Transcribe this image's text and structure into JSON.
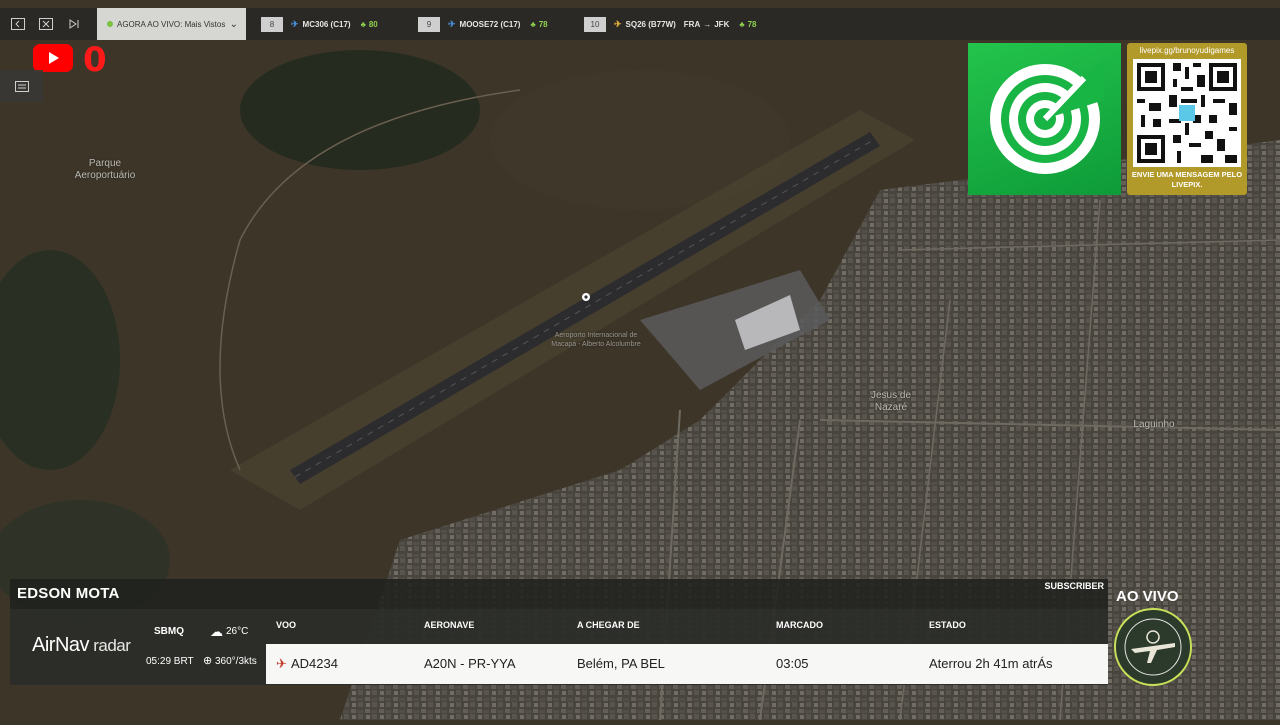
{
  "topbar": {
    "live_label": "AGORA AO VIVO: Mais Vistos",
    "flights": [
      {
        "rank": "8",
        "callsign": "MC306 (C17)",
        "route_from": "",
        "route_to": "",
        "fuel": "80"
      },
      {
        "rank": "9",
        "callsign": "MOOSE72 (C17)",
        "route_from": "",
        "route_to": "",
        "fuel": "78"
      },
      {
        "rank": "10",
        "callsign": "SQ26 (B77W)",
        "route_from": "FRA",
        "route_to": "JFK",
        "fuel": "78"
      }
    ]
  },
  "youtube": {
    "count": "0"
  },
  "map": {
    "labels": {
      "park": "Parque Aeroportuário",
      "airport": "Aeroporto Internacional de Macapá - Alberto Alcolumbre",
      "district": "Jesus de Nazaré",
      "laguinho": "Laguinho"
    }
  },
  "livepix": {
    "url": "livepix.gg/brunoyudigames",
    "message": "ENVIE UMA MENSAGEM PELO LIVEPIX."
  },
  "panel": {
    "streamer": "EDSON MOTA",
    "subscriber": "SUBSCRIBER",
    "logo_main": "AirNav",
    "logo_sub": " radar",
    "airport_code": "SBMQ",
    "local_time": "05:29 BRT",
    "temperature": "26°C",
    "wind": "360°/3kts",
    "headers": {
      "flight": "VOO",
      "aircraft": "AERONAVE",
      "from": "A CHEGAR DE",
      "scheduled": "MARCADO",
      "status": "ESTADO"
    },
    "row": {
      "flight": "AD4234",
      "aircraft": "A20N - PR-YYA",
      "from": "Belém, PA BEL",
      "scheduled": "03:05",
      "status": "Aterrou 2h 41m atrÁs"
    }
  },
  "ao_vivo": "AO VIVO",
  "colors": {
    "accent_green": "#1fb848",
    "live_red": "#ff0000",
    "livepix_gold": "#b29a2a"
  }
}
